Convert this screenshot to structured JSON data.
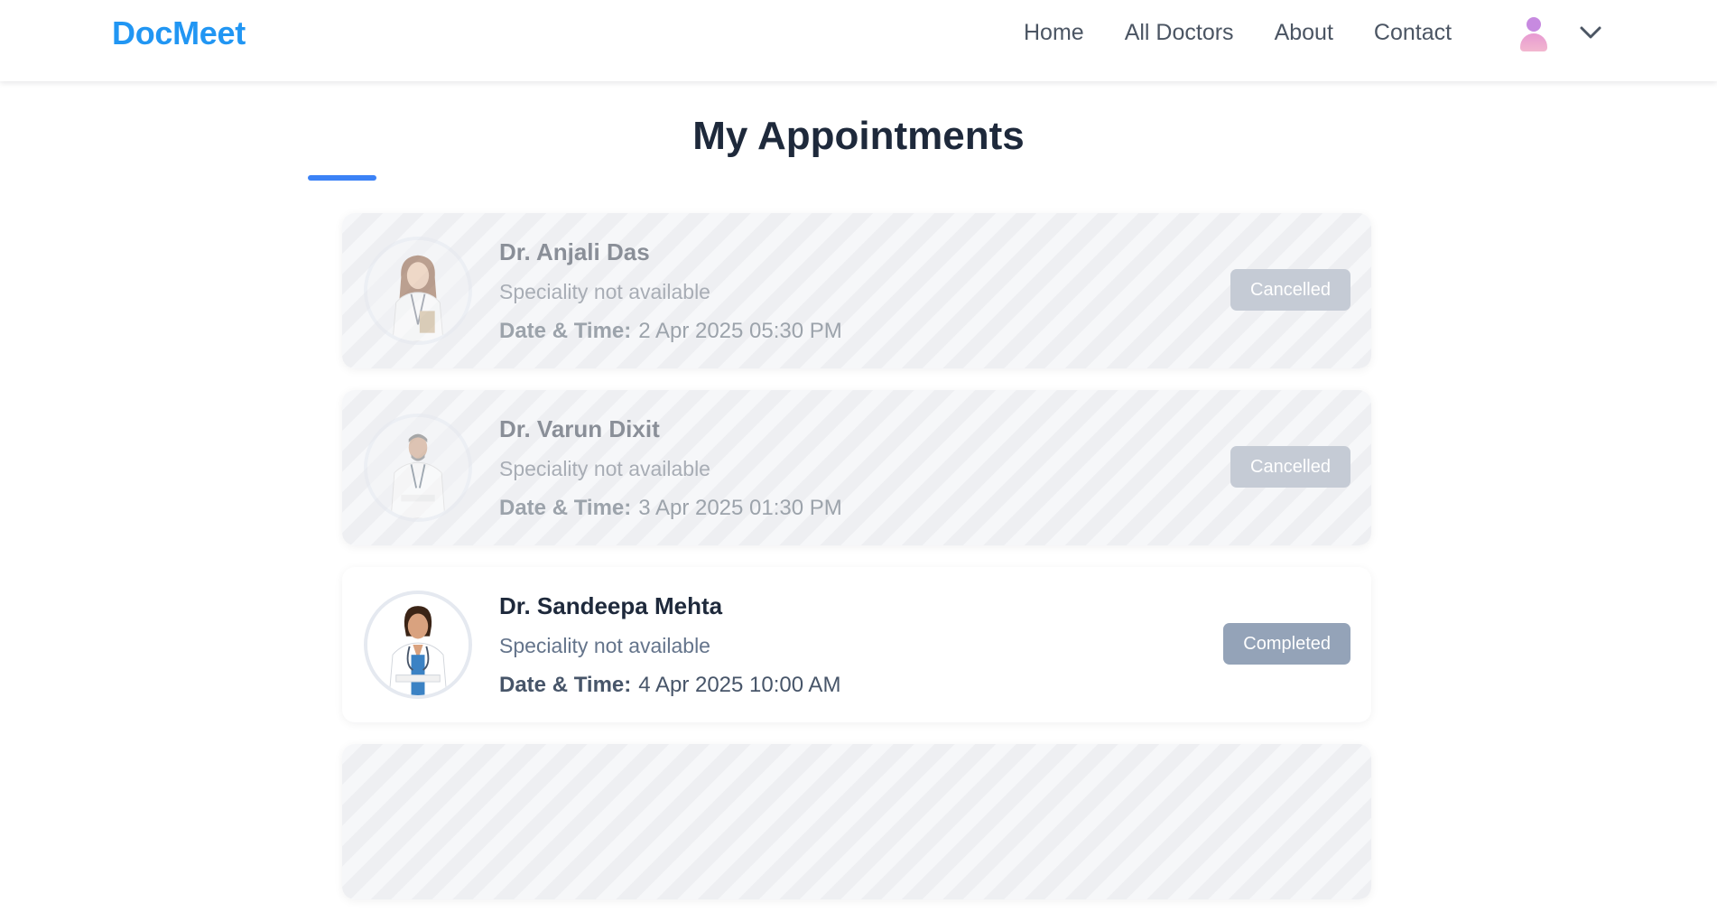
{
  "brand": {
    "name": "DocMeet",
    "color": "#2196f3"
  },
  "nav": {
    "links": [
      "Home",
      "All Doctors",
      "About",
      "Contact"
    ],
    "avatar_icon": "user-avatar-icon",
    "dropdown_icon": "chevron-down-icon"
  },
  "main": {
    "title": "My Appointments",
    "accent_color": "#3b82f6",
    "date_time_label": "Date & Time:",
    "appointments": [
      {
        "doctor": "Dr. Anjali Das",
        "speciality": "Speciality not available",
        "datetime": "2 Apr 2025 05:30 PM",
        "status": "Cancelled"
      },
      {
        "doctor": "Dr. Varun Dixit",
        "speciality": "Speciality not available",
        "datetime": "3 Apr 2025 01:30 PM",
        "status": "Cancelled"
      },
      {
        "doctor": "Dr. Sandeepa Mehta",
        "speciality": "Speciality not available",
        "datetime": "4 Apr 2025 10:00 AM",
        "status": "Completed"
      }
    ]
  }
}
